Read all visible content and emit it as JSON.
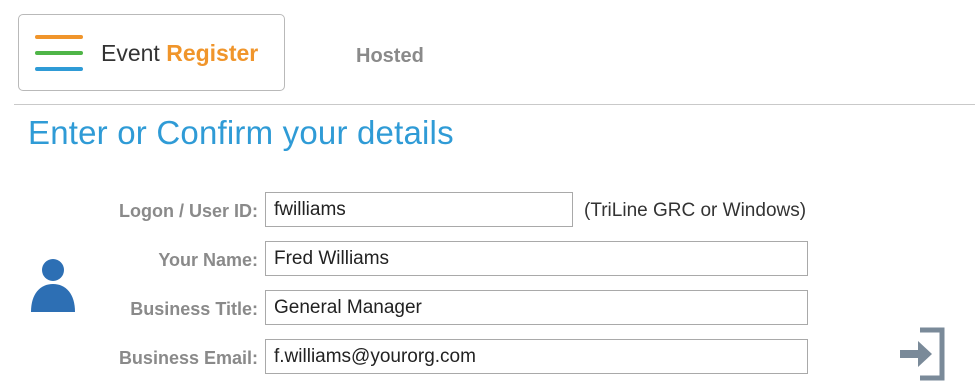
{
  "header": {
    "logo": {
      "word1": "Event",
      "word2": "Register",
      "icon": "hamburger-icon",
      "colors": {
        "bar_top": "#f0952b",
        "bar_middle": "#4fb548",
        "bar_bottom": "#2f9bd6",
        "word1": "#333333",
        "word2": "#f0952b"
      }
    },
    "tab_hosted": "Hosted"
  },
  "main": {
    "title": "Enter or Confirm your details",
    "title_color": "#2f9bd6",
    "avatar_icon": "user-icon",
    "avatar_color": "#2d6fb4",
    "form": {
      "logon": {
        "label": "Logon / User ID:",
        "value": "fwilliams",
        "hint": "(TriLine GRC or Windows)"
      },
      "name": {
        "label": "Your Name:",
        "value": "Fred Williams"
      },
      "title": {
        "label": "Business Title:",
        "value": "General Manager"
      },
      "email": {
        "label": "Business Email:",
        "value": "f.williams@yourorg.com"
      }
    },
    "next_button": {
      "icon": "arrow-right-into-box-icon",
      "color": "#7a8a99"
    }
  }
}
